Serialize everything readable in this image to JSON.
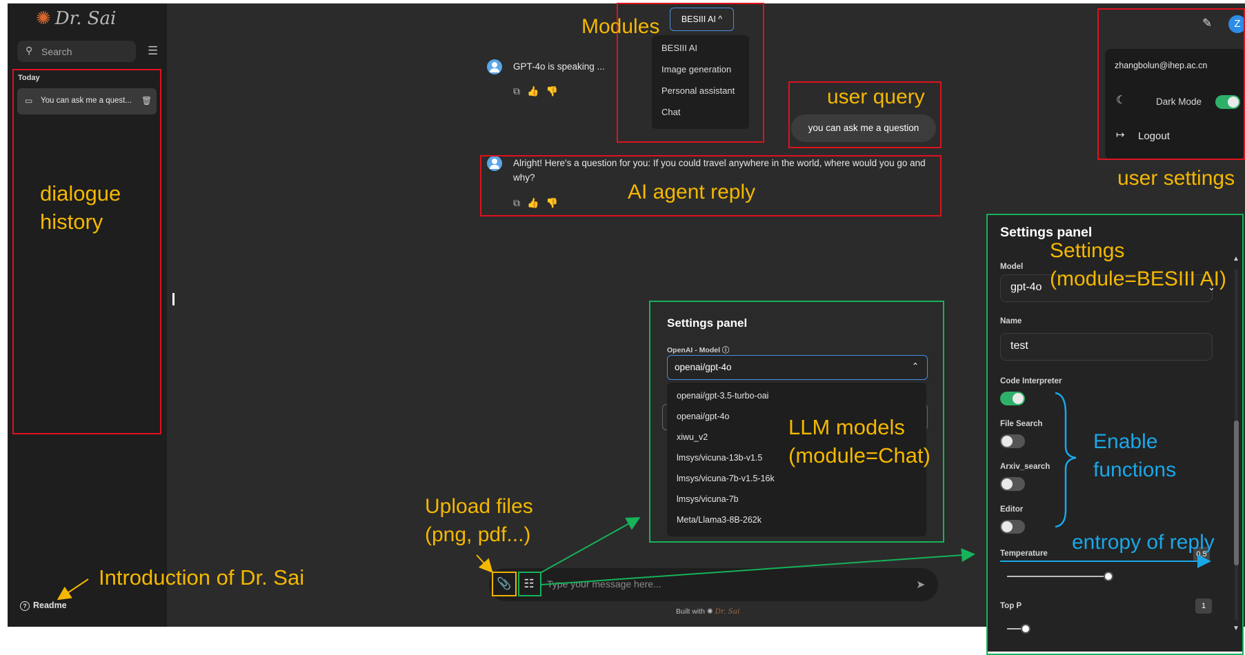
{
  "app": {
    "logo_text": "Dr. Sai",
    "logo_mark": "✺"
  },
  "sidebar": {
    "search_placeholder": "Search",
    "section_today": "Today",
    "conversations": [
      {
        "title": "You can ask me a quest..."
      }
    ],
    "readme_label": "Readme"
  },
  "module_selector": {
    "selected": "BESIII AI ^",
    "options": [
      "BESIII AI",
      "Image generation",
      "Personal assistant",
      "Chat"
    ]
  },
  "chat": {
    "messages": [
      {
        "role": "assistant",
        "text": "GPT-4o is speaking ..."
      },
      {
        "role": "user",
        "text": "you can ask me a question"
      },
      {
        "role": "assistant",
        "text": "Alright! Here's a question for you: If you could travel anywhere in the world, where would you go and why?"
      }
    ],
    "input_placeholder": "Type your message here...",
    "built_with": "Built with",
    "built_brand": "Dr. Sai"
  },
  "user_menu": {
    "avatar_letter": "Z",
    "email": "zhangbolun@ihep.ac.cn",
    "dark_mode_label": "Dark Mode",
    "dark_mode_on": true,
    "logout_label": "Logout"
  },
  "center_settings": {
    "title": "Settings panel",
    "model_label": "OpenAI - Model ⓘ",
    "selected_model": "openai/gpt-4o",
    "model_options": [
      "openai/gpt-3.5-turbo-oai",
      "openai/gpt-4o",
      "xiwu_v2",
      "lmsys/vicuna-13b-v1.5",
      "lmsys/vicuna-7b-v1.5-16k",
      "lmsys/vicuna-7b",
      "Meta/Llama3-8B-262k"
    ]
  },
  "right_settings": {
    "title": "Settings panel",
    "model_label": "Model",
    "model_value": "gpt-4o",
    "name_label": "Name",
    "name_value": "test",
    "toggles": [
      {
        "label": "Code Interpreter",
        "on": true
      },
      {
        "label": "File Search",
        "on": false
      },
      {
        "label": "Arxiv_search",
        "on": false
      },
      {
        "label": "Editor",
        "on": false
      }
    ],
    "temperature_label": "Temperature",
    "temperature_value": "0.5",
    "top_p_label": "Top P",
    "top_p_value": "1"
  },
  "annotations": {
    "modules": "Modules",
    "user_query": "user query",
    "ai_reply": "AI agent reply",
    "user_settings": "user settings",
    "dialogue_history_1": "dialogue",
    "dialogue_history_2": "history",
    "settings_1": "Settings",
    "settings_2": "(module=BESIII AI)",
    "llm_1": "LLM models",
    "llm_2": "(module=Chat)",
    "upload_1": "Upload files",
    "upload_2": "(png, pdf...)",
    "intro": "Introduction of Dr. Sai",
    "enable_1": "Enable",
    "enable_2": "functions",
    "entropy": "entropy of reply"
  },
  "colors": {
    "annotation_red": "#e0121e",
    "annotation_green": "#16b35a",
    "annotation_orange": "#f5b800",
    "annotation_blue": "#1aa7e8",
    "accent_blue": "#4a8fe0",
    "toggle_on": "#2fb06a"
  }
}
